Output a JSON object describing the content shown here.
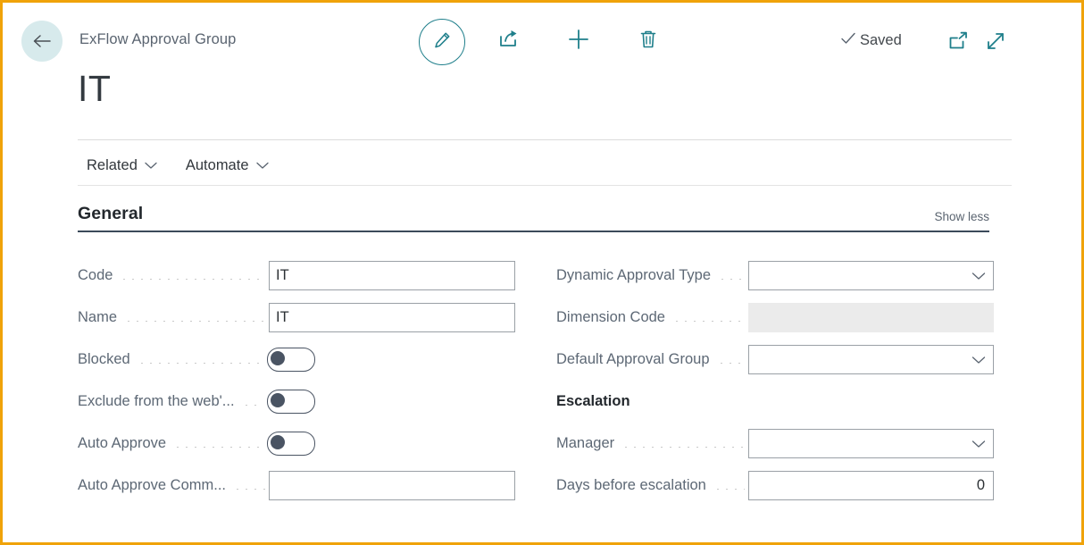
{
  "window": {
    "focus_border_color": "#f0a30a",
    "accent_color": "#1f7f8b"
  },
  "header": {
    "back_label": "Back",
    "breadcrumb": "ExFlow Approval Group",
    "title": "IT",
    "save_status": "Saved",
    "tools": [
      {
        "name": "edit-record-button",
        "icon": "pencil-icon"
      },
      {
        "name": "share-button",
        "icon": "share-icon"
      },
      {
        "name": "new-record-button",
        "icon": "plus-icon"
      },
      {
        "name": "delete-record-button",
        "icon": "trash-icon"
      }
    ],
    "popout_label": "Open in new window",
    "expand_label": "Expand"
  },
  "actions": {
    "related_label": "Related",
    "automate_label": "Automate"
  },
  "general": {
    "section_title": "General",
    "show_less_label": "Show less",
    "left_fields": {
      "code": {
        "label": "Code",
        "value": "IT"
      },
      "name": {
        "label": "Name",
        "value": "IT"
      },
      "blocked": {
        "label": "Blocked",
        "value": "off"
      },
      "exclude_from_web": {
        "label": "Exclude from the web'...",
        "value": "off"
      },
      "auto_approve": {
        "label": "Auto Approve",
        "value": "off"
      },
      "auto_approve_comment": {
        "label": "Auto Approve Comm...",
        "value": ""
      }
    },
    "right_fields": {
      "dynamic_approval_type": {
        "label": "Dynamic Approval Type",
        "value": ""
      },
      "dimension_code": {
        "label": "Dimension Code",
        "value": ""
      },
      "default_approval_group": {
        "label": "Default Approval Group",
        "value": ""
      },
      "escalation_title": "Escalation",
      "manager": {
        "label": "Manager",
        "value": ""
      },
      "days_before_escalation": {
        "label": "Days before escalation",
        "value": "0"
      }
    }
  }
}
